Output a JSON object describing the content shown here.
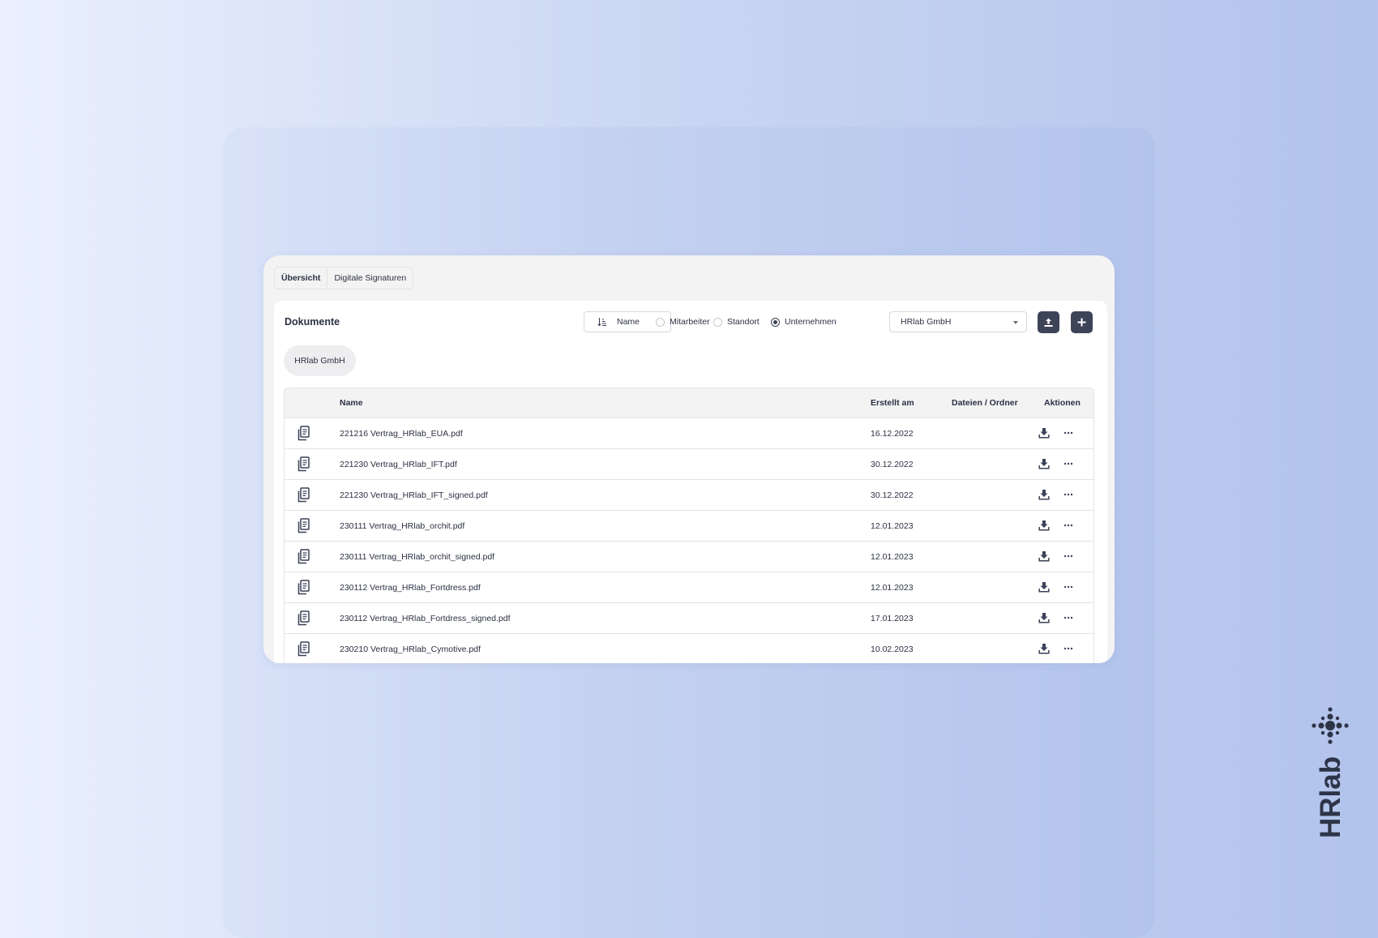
{
  "tabs": [
    {
      "label": "Übersicht",
      "active": true
    },
    {
      "label": "Digitale Signaturen",
      "active": false
    }
  ],
  "panel": {
    "title": "Dokumente"
  },
  "sort": {
    "label": "Name",
    "icon": "sort-ascending-icon"
  },
  "scope_options": [
    {
      "label": "Mitarbeiter",
      "checked": false
    },
    {
      "label": "Standort",
      "checked": false
    },
    {
      "label": "Unternehmen",
      "checked": true
    }
  ],
  "company_select": {
    "value": "HRlab GmbH"
  },
  "buttons": {
    "upload_icon": "upload-icon",
    "add_icon": "plus-icon"
  },
  "breadcrumb": {
    "chip": "HRlab GmbH"
  },
  "table": {
    "columns": {
      "name": "Name",
      "created": "Erstellt am",
      "files": "Dateien / Ordner",
      "actions": "Aktionen"
    },
    "rows": [
      {
        "name": "221216 Vertrag_HRlab_EUA.pdf",
        "date": "16.12.2022"
      },
      {
        "name": "221230 Vertrag_HRlab_IFT.pdf",
        "date": "30.12.2022"
      },
      {
        "name": "221230 Vertrag_HRlab_IFT_signed.pdf",
        "date": "30.12.2022"
      },
      {
        "name": "230111 Vertrag_HRlab_orchit.pdf",
        "date": "12.01.2023"
      },
      {
        "name": "230111 Vertrag_HRlab_orchit_signed.pdf",
        "date": "12.01.2023"
      },
      {
        "name": "230112 Vertrag_HRlab_Fortdress.pdf",
        "date": "12.01.2023"
      },
      {
        "name": "230112 Vertrag_HRlab_Fortdress_signed.pdf",
        "date": "17.01.2023"
      },
      {
        "name": "230210 Vertrag_HRlab_Cymotive.pdf",
        "date": "10.02.2023"
      }
    ]
  },
  "brand": {
    "logo_text": "HRlab"
  },
  "colors": {
    "primary": "#3e4458",
    "text": "#2b3042",
    "background": "#c9d5f2"
  }
}
